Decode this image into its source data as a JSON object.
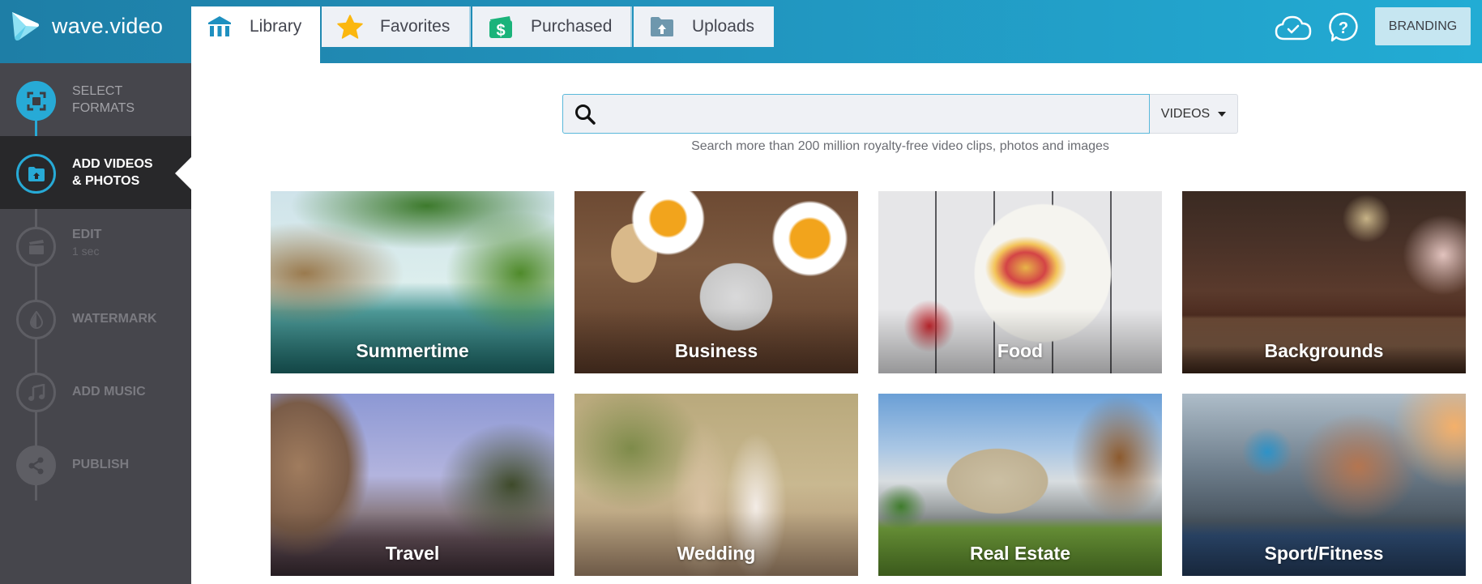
{
  "app": {
    "name": "wave.video",
    "brand_color": "#22acd4"
  },
  "header": {
    "tabs": [
      {
        "label": "Library",
        "icon": "library-icon",
        "active": true
      },
      {
        "label": "Favorites",
        "icon": "star-icon",
        "active": false
      },
      {
        "label": "Purchased",
        "icon": "purchased-dollar-icon",
        "active": false
      },
      {
        "label": "Uploads",
        "icon": "upload-folder-icon",
        "active": false
      }
    ],
    "icons": [
      "cloud-check-icon",
      "help-icon"
    ],
    "branding_label": "BRANDING"
  },
  "sidebar": {
    "steps": [
      {
        "label_line1": "SELECT",
        "label_line2": "FORMATS",
        "icon": "select-formats-icon",
        "state": "done"
      },
      {
        "label_line1": "ADD VIDEOS",
        "label_line2": "& PHOTOS",
        "icon": "add-media-folder-icon",
        "state": "active"
      },
      {
        "label_line1": "EDIT",
        "sub": "1 sec",
        "icon": "clapperboard-icon",
        "state": "pending"
      },
      {
        "label_line1": "WATERMARK",
        "icon": "watermark-drop-icon",
        "state": "pending"
      },
      {
        "label_line1": "ADD MUSIC",
        "icon": "music-note-icon",
        "state": "pending"
      },
      {
        "label_line1": "PUBLISH",
        "icon": "share-icon",
        "state": "pending"
      }
    ]
  },
  "search": {
    "value": "",
    "placeholder": "",
    "type_selected": "VIDEOS",
    "hint": "Search more than 200 million royalty-free video clips, photos and images"
  },
  "categories": [
    {
      "label": "Summertime"
    },
    {
      "label": "Business"
    },
    {
      "label": "Food"
    },
    {
      "label": "Backgrounds"
    },
    {
      "label": "Travel"
    },
    {
      "label": "Wedding"
    },
    {
      "label": "Real Estate"
    },
    {
      "label": "Sport/Fitness"
    }
  ]
}
